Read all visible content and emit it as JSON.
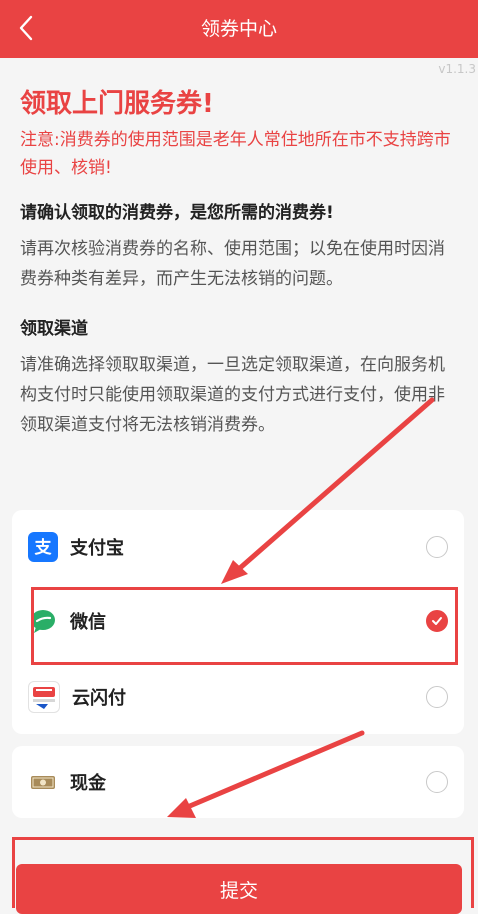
{
  "header": {
    "title": "领券中心"
  },
  "version": "v1.1.3",
  "content": {
    "main_title": "领取上门服务券!",
    "notice": "注意:消费券的使用范围是老年人常住地所在市不支持跨市使用、核销!",
    "confirm_title": "请确认领取的消费券，是您所需的消费券!",
    "confirm_text": "请再次核验消费券的名称、使用范围；以免在使用时因消费券种类有差异，而产生无法核销的问题。",
    "channel_title": "领取渠道",
    "channel_text": "请准确选择领取取渠道，一旦选定领取渠道，在向服务机构支付时只能使用领取渠道的支付方式进行支付，使用非领取渠道支付将无法核销消费券。"
  },
  "payment_options": [
    {
      "label": "支付宝",
      "icon": "alipay-icon",
      "selected": false
    },
    {
      "label": "微信",
      "icon": "wechat-icon",
      "selected": true
    },
    {
      "label": "云闪付",
      "icon": "unionpay-quickpass-icon",
      "selected": false
    }
  ],
  "cash_option": {
    "label": "现金",
    "icon": "cash-icon",
    "selected": false
  },
  "submit_label": "提交",
  "colors": {
    "accent": "#e94343",
    "alipay": "#1677ff",
    "wechat": "#2aae67",
    "cash": "#a88b5a"
  }
}
